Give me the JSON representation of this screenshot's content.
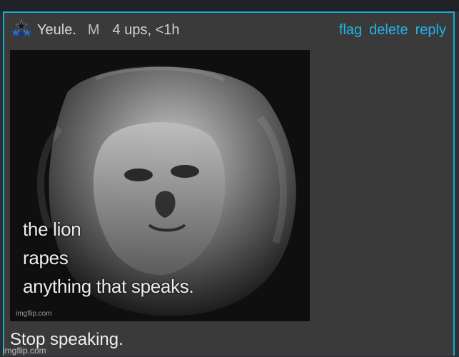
{
  "comment": {
    "username": "Yeule.",
    "mod_badge": "M",
    "meta": "4 ups, <1h",
    "actions": [
      "flag",
      "delete",
      "reply"
    ],
    "meme": {
      "lines": [
        "the lion",
        "rapes",
        "anything that speaks."
      ],
      "watermark": "imgflip.com"
    },
    "text": "Stop speaking."
  },
  "page_watermark": "imgflip.com",
  "colors": {
    "accent": "#17a9d9",
    "link": "#21b3e8",
    "background": "#3a3a3a"
  },
  "icons": {
    "avatar": "stars-avatar-icon"
  }
}
